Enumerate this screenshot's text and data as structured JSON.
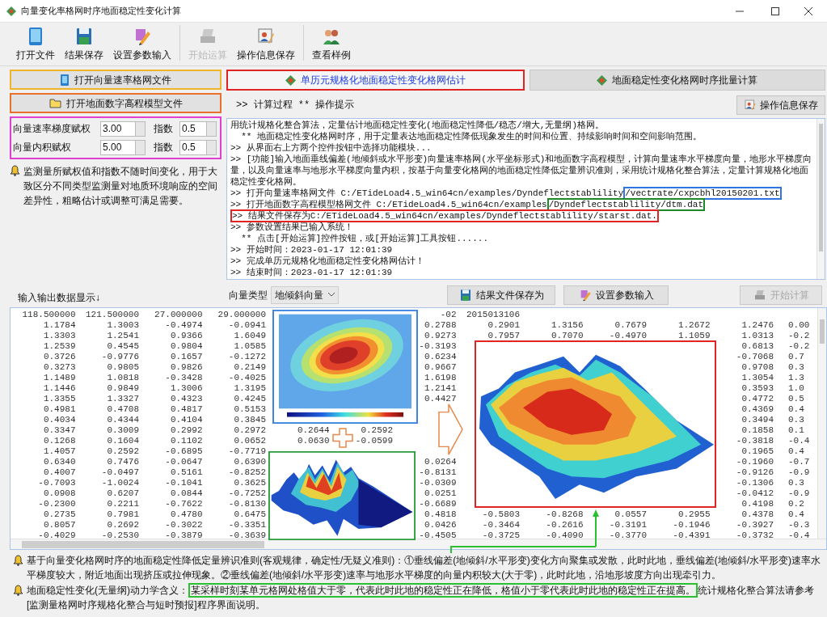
{
  "window": {
    "title": "向量变化率格网时序地面稳定性变化计算"
  },
  "toolbar": [
    {
      "label": "打开文件",
      "disabled": false
    },
    {
      "label": "结果保存",
      "disabled": false
    },
    {
      "label": "设置参数输入",
      "disabled": false
    },
    {
      "label": "开始运算",
      "disabled": true
    },
    {
      "label": "操作信息保存",
      "disabled": false
    },
    {
      "label": "查看样例",
      "disabled": false
    }
  ],
  "left_panel": {
    "buttons": [
      "打开向量速率格网文件",
      "打开地面数字高程模型文件"
    ],
    "params": [
      {
        "label": "向量速率梯度赋权",
        "value": "3.00",
        "exponent_label": "指数",
        "exponent": "0.5"
      },
      {
        "label": "向量内积赋权",
        "value": "5.00",
        "exponent_label": "指数",
        "exponent": "0.5"
      }
    ],
    "note": "监测量所赋权值和指数不随时间变化，用于大致区分不同类型监测量对地质环境响应的空间差异性，粗略估计或调整可满足需要。"
  },
  "tabs": [
    {
      "label": "单历元规格化地面稳定性变化格网估计",
      "selected": true
    },
    {
      "label": "地面稳定性变化格网时序批量计算",
      "selected": false
    }
  ],
  "log_header": {
    "text": ">> 计算过程  ** 操作提示",
    "button": "操作信息保存"
  },
  "log": [
    {
      "text": "用统计规格化整合算法，定量估计地面稳定性变化(地面稳定性降低/稳态/增大,无量纲)格网。"
    },
    {
      "text": "  ** 地面稳定性变化格网时序，用于定量表达地面稳定性降低现象发生的时间和位置、持续影响时间和空间影响范围。"
    },
    {
      "text": ">> 从界面右上方两个控件按钮中选择功能模块..."
    },
    {
      "text": ">> [功能]输入地面垂线偏差(地倾斜或水平形变)向量速率格网(水平坐标形式)和地面数字高程模型，计算向量速率水平梯度向量，地形水平梯度向量，以及向量速率与地形水平梯度向量内积，按基于向量变化格网的地面稳定性降低定量辨识准则，采用统计规格化整合算法，定量计算规格化地面稳定性变化格网。"
    },
    {
      "text": ">> 打开向量速率格网文件 C:/ETideLoad4.5_win64cn/examples/Dyndeflectstablility",
      "mark": "/vectrate/cxpcbhl20150201.txt",
      "color": "#2f74e0"
    },
    {
      "text": ">> 打开地面数字高程模型格网文件 C:/ETideLoad4.5_win64cn/examples",
      "mark": "/Dyndeflectstablility/dtm.dat",
      "color": "#1d8a2a"
    },
    {
      "mark": ">> 结果文件保存为C:/ETideLoad4.5_win64cn/examples/Dyndeflectstablility/starst.dat.",
      "color": "#e02424"
    },
    {
      "text": ">> 参数设置结果已输入系统！"
    },
    {
      "text": "  ** 点击[开始运算]控件按钮，或[开始运算]工具按钮......"
    },
    {
      "text": ">> 开始时间：2023-01-17 12:01:39"
    },
    {
      "text": ">> 完成单历元规格化地面稳定性变化格网估计！"
    },
    {
      "text": ">> 结束时间：2023-01-17 12:01:39"
    }
  ],
  "data_label": "输入输出数据显示↓",
  "vector_type": {
    "label": "向量类型",
    "value": "地倾斜向量"
  },
  "actions": [
    {
      "label": "结果文件保存为",
      "disabled": false
    },
    {
      "label": "设置参数输入",
      "disabled": false
    },
    {
      "label": "开始计算",
      "disabled": true
    }
  ],
  "table": {
    "rows": [
      [
        "118.500000",
        "121.500000",
        "27.000000",
        "29.000000",
        null,
        null,
        "-02",
        "2015013106",
        null,
        null,
        null,
        null,
        null
      ],
      [
        "1.1784",
        "1.3003",
        "-0.4974",
        "-0.0941",
        null,
        null,
        "0.2788",
        "0.2901",
        "1.3156",
        "0.7679",
        "1.2672",
        "1.2476",
        "0.00"
      ],
      [
        "1.3303",
        "1.2541",
        "0.9366",
        "1.6049",
        null,
        null,
        "0.9273",
        "0.7957",
        "0.7070",
        "-0.4970",
        "1.1059",
        "1.0313",
        "-0.2"
      ],
      [
        "1.2539",
        "0.4545",
        "0.9804",
        "1.0585",
        null,
        null,
        "-0.3193",
        null,
        null,
        null,
        null,
        "0.6813",
        "-0.2"
      ],
      [
        "0.3726",
        "-0.9776",
        "0.1657",
        "-0.1272",
        null,
        null,
        "0.6234",
        null,
        null,
        null,
        null,
        "-0.7068",
        "0.7"
      ],
      [
        "0.3273",
        "0.9805",
        "0.9826",
        "0.2149",
        null,
        null,
        "0.9667",
        null,
        null,
        null,
        null,
        "0.9708",
        "0.3"
      ],
      [
        "1.1489",
        "1.0818",
        "-0.3428",
        "-0.4025",
        null,
        null,
        "1.6198",
        null,
        null,
        null,
        null,
        "1.3054",
        "1.3"
      ],
      [
        "1.1446",
        "0.9849",
        "1.3006",
        "1.3195",
        null,
        null,
        "1.2141",
        null,
        null,
        null,
        null,
        "0.3593",
        "1.0"
      ],
      [
        "1.3355",
        "1.3327",
        "0.4323",
        "0.4245",
        null,
        null,
        "0.4427",
        null,
        null,
        null,
        null,
        "0.4772",
        "0.5"
      ],
      [
        "0.4981",
        "0.4708",
        "0.4817",
        "0.5153",
        null,
        null,
        null,
        null,
        null,
        null,
        null,
        "0.4369",
        "0.4"
      ],
      [
        "0.4034",
        "0.4344",
        "0.4104",
        "0.3845",
        null,
        null,
        null,
        null,
        null,
        null,
        null,
        "0.3494",
        "0.3"
      ],
      [
        "0.3347",
        "0.3009",
        "0.2992",
        "0.2972",
        "0.2644",
        "0.2592",
        null,
        null,
        null,
        null,
        null,
        "0.1858",
        "0.1"
      ],
      [
        "0.1268",
        "0.1604",
        "0.1102",
        "0.0652",
        "0.0630",
        "-0.0599",
        null,
        null,
        null,
        null,
        null,
        "-0.3818",
        "-0.4"
      ],
      [
        "1.4057",
        "0.2592",
        "-0.6895",
        "-0.7719",
        null,
        null,
        null,
        null,
        null,
        null,
        null,
        "0.1965",
        "0.4"
      ],
      [
        "0.6340",
        "0.7476",
        "-0.0647",
        "0.6390",
        null,
        null,
        "0.0264",
        null,
        null,
        null,
        null,
        "-0.1960",
        "-0.7"
      ],
      [
        "0.4007",
        "-0.0497",
        "0.5161",
        "-0.8252",
        null,
        null,
        "-0.8131",
        null,
        null,
        null,
        null,
        "-0.9126",
        "-0.9"
      ],
      [
        "-0.7093",
        "-1.0024",
        "-0.1041",
        "0.3625",
        null,
        null,
        "-0.0309",
        null,
        null,
        null,
        null,
        "-0.1306",
        "0.3"
      ],
      [
        "0.0908",
        "0.6207",
        "0.0844",
        "-0.7252",
        null,
        null,
        "0.0251",
        null,
        null,
        null,
        null,
        "-0.0412",
        "-0.9"
      ],
      [
        "-0.2300",
        "0.2211",
        "-0.7622",
        "-0.8130",
        null,
        null,
        "-0.6689",
        null,
        null,
        null,
        null,
        "0.4198",
        "0.2"
      ],
      [
        "0.2735",
        "0.7981",
        "0.4780",
        "0.6475",
        null,
        null,
        "0.4818",
        "-0.5803",
        "-0.8268",
        "0.0557",
        "0.2955",
        "0.4378",
        "0.4"
      ],
      [
        "0.8057",
        "0.2692",
        "-0.3022",
        "-0.3351",
        null,
        null,
        "0.0426",
        "-0.3464",
        "-0.2616",
        "-0.3191",
        "-0.1946",
        "-0.3927",
        "-0.3"
      ],
      [
        "-0.4029",
        "-0.2530",
        "-0.3879",
        "-0.3639",
        null,
        null,
        "-0.4505",
        "-0.3725",
        "-0.4090",
        "-0.3770",
        "-0.4391",
        "-0.3732",
        "-0.4"
      ]
    ]
  },
  "notes": [
    {
      "text": "基于向量变化格网时序的地面稳定性降低定量辨识准则(客观规律，确定性/无疑义准则)：①垂线偏差(地倾斜/水平形变)变化方向聚集或发散，此时此地，垂线偏差(地倾斜/水平形变)速率水平梯度较大，附近地面出现挤压或拉伸现象。②垂线偏差(地倾斜/水平形变)速率与地形水平梯度的向量内积较大(大于零)，此时此地，沿地形坡度方向出现牵引力。"
    },
    {
      "text": "地面稳定性变化(无量纲)动力学含义：",
      "mark": "某采样时刻某单元格网处格值大于零，代表此时此地的稳定性正在降低，格值小于零代表此时此地的稳定性正在提高。",
      "rest": "统计规格化整合算法请参考[监测量格网时序规格化整合与短时预报]程序界面说明。"
    }
  ]
}
